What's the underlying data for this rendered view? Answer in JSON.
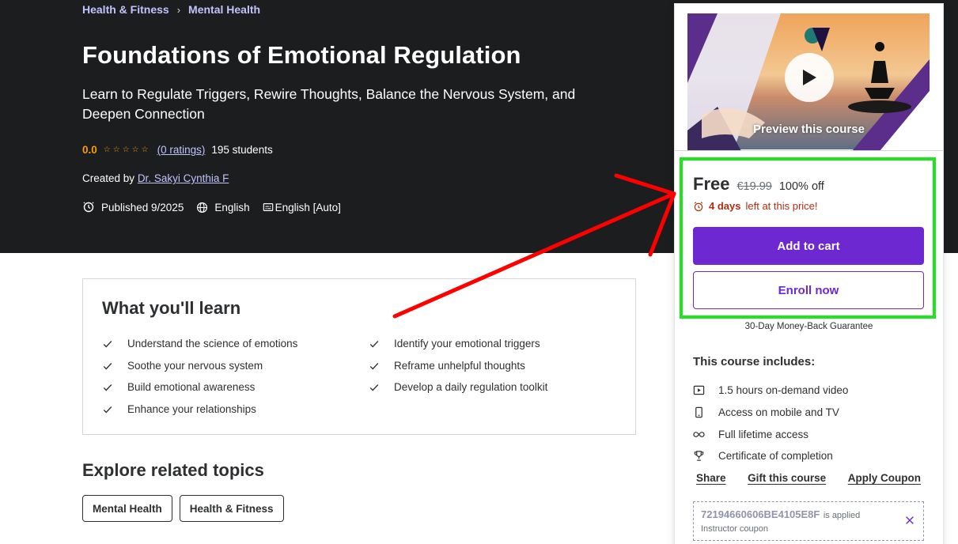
{
  "breadcrumb": {
    "items": [
      "Health & Fitness",
      "Mental Health"
    ],
    "separator": "›"
  },
  "course": {
    "title": "Foundations of Emotional Regulation",
    "subtitle": "Learn to Regulate Triggers, Rewire Thoughts, Balance the Nervous System, and Deepen Connection",
    "rating_score": "0.0",
    "rating_stars": "☆☆☆☆☆",
    "ratings_count": "(0 ratings)",
    "students": "195 students",
    "created_by_label": "Created by",
    "author": "Dr. Sakyi Cynthia F",
    "published": "Published 9/2025",
    "language": "English",
    "captions": "English [Auto]"
  },
  "learn": {
    "title": "What you'll learn",
    "items": [
      "Understand the science of emotions",
      "Identify your emotional triggers",
      "Soothe your nervous system",
      "Reframe unhelpful thoughts",
      "Build emotional awareness",
      "Develop a daily regulation toolkit",
      "Enhance your relationships"
    ]
  },
  "related": {
    "title": "Explore related topics",
    "topics": [
      "Mental Health",
      "Health & Fitness"
    ]
  },
  "sidebar": {
    "preview_label": "Preview this course",
    "price_now": "Free",
    "price_old": "€19.99",
    "discount": "100% off",
    "timer_bold": "4 days",
    "timer_rest": "left at this price!",
    "add_to_cart": "Add to cart",
    "enroll_now": "Enroll now",
    "guarantee": "30-Day Money-Back Guarantee",
    "includes_title": "This course includes:",
    "includes": [
      {
        "icon": "video-icon",
        "label": "1.5 hours on-demand video"
      },
      {
        "icon": "mobile-icon",
        "label": "Access on mobile and TV"
      },
      {
        "icon": "infinity-icon",
        "label": "Full lifetime access"
      },
      {
        "icon": "trophy-icon",
        "label": "Certificate of completion"
      }
    ],
    "links": {
      "share": "Share",
      "gift": "Gift this course",
      "coupon": "Apply Coupon"
    },
    "coupon": {
      "code": "72194660606BE4105E8F",
      "applied": "is applied",
      "type": "Instructor coupon"
    }
  },
  "colors": {
    "hero_bg": "#1c1d1f",
    "accent_purple": "#6d28d2",
    "link_lavender": "#c0c4fc",
    "star_orange": "#f69c08",
    "timer_red": "#b32d0f",
    "highlight_green": "#1ee51e",
    "annotation_red": "#ff0000"
  }
}
